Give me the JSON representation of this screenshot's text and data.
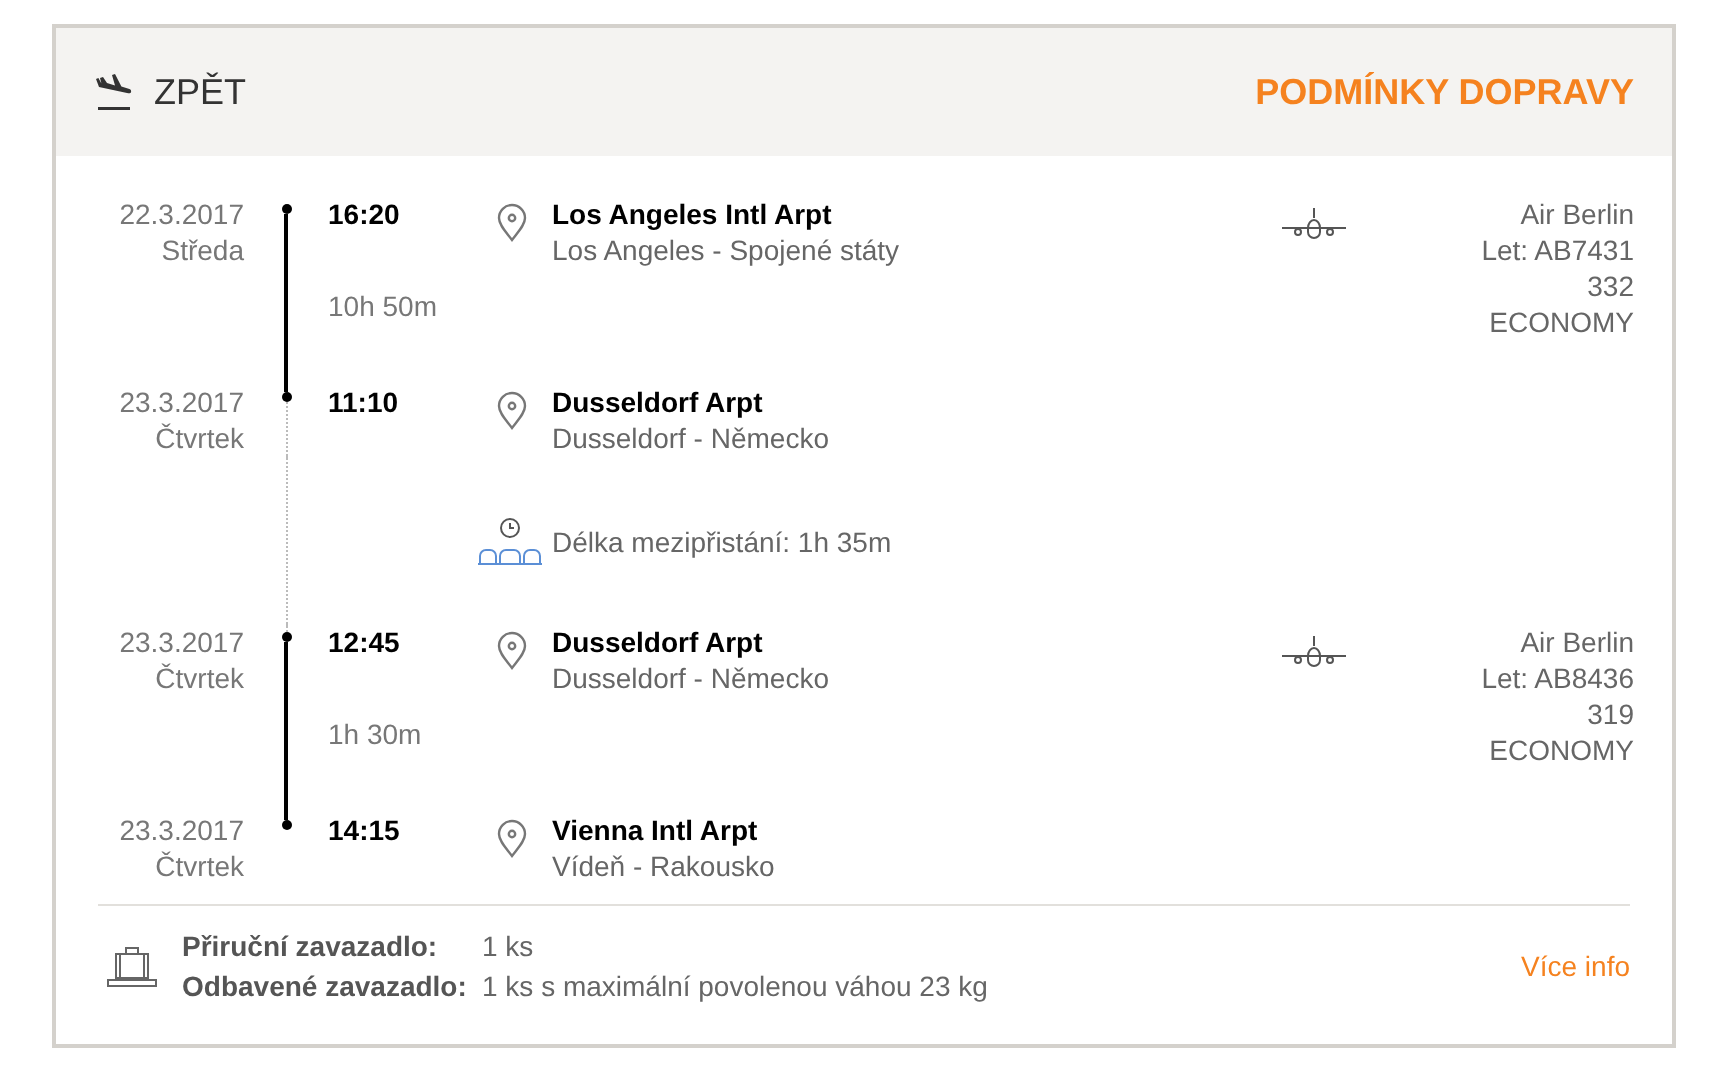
{
  "header": {
    "back_label": "ZPĚT",
    "title": "PODMÍNKY DOPRAVY"
  },
  "itinerary": [
    {
      "kind": "segment",
      "departure": {
        "date": "22.3.2017",
        "day": "Středa",
        "time": "16:20",
        "airport": "Los Angeles Intl Arpt",
        "place": "Los Angeles - Spojené státy"
      },
      "duration": "10h 50m",
      "arrival": {
        "date": "23.3.2017",
        "day": "Čtvrtek",
        "time": "11:10",
        "airport": "Dusseldorf Arpt",
        "place": "Dusseldorf - Německo"
      },
      "airline": "Air Berlin",
      "flight": "Let: AB7431",
      "aircraft": "332",
      "cabin": "ECONOMY"
    },
    {
      "kind": "layover",
      "text": "Délka mezipřistání: 1h 35m"
    },
    {
      "kind": "segment",
      "departure": {
        "date": "23.3.2017",
        "day": "Čtvrtek",
        "time": "12:45",
        "airport": "Dusseldorf Arpt",
        "place": "Dusseldorf - Německo"
      },
      "duration": "1h 30m",
      "arrival": {
        "date": "23.3.2017",
        "day": "Čtvrtek",
        "time": "14:15",
        "airport": "Vienna Intl Arpt",
        "place": "Vídeň - Rakousko"
      },
      "airline": "Air Berlin",
      "flight": "Let: AB8436",
      "aircraft": "319",
      "cabin": "ECONOMY"
    }
  ],
  "baggage": [
    {
      "label": "Přiruční zavazadlo:",
      "value": "1 ks"
    },
    {
      "label": "Odbavené zavazadlo:",
      "value": "1 ks s maximální povolenou váhou 23 kg"
    }
  ],
  "more_link": "Více info"
}
